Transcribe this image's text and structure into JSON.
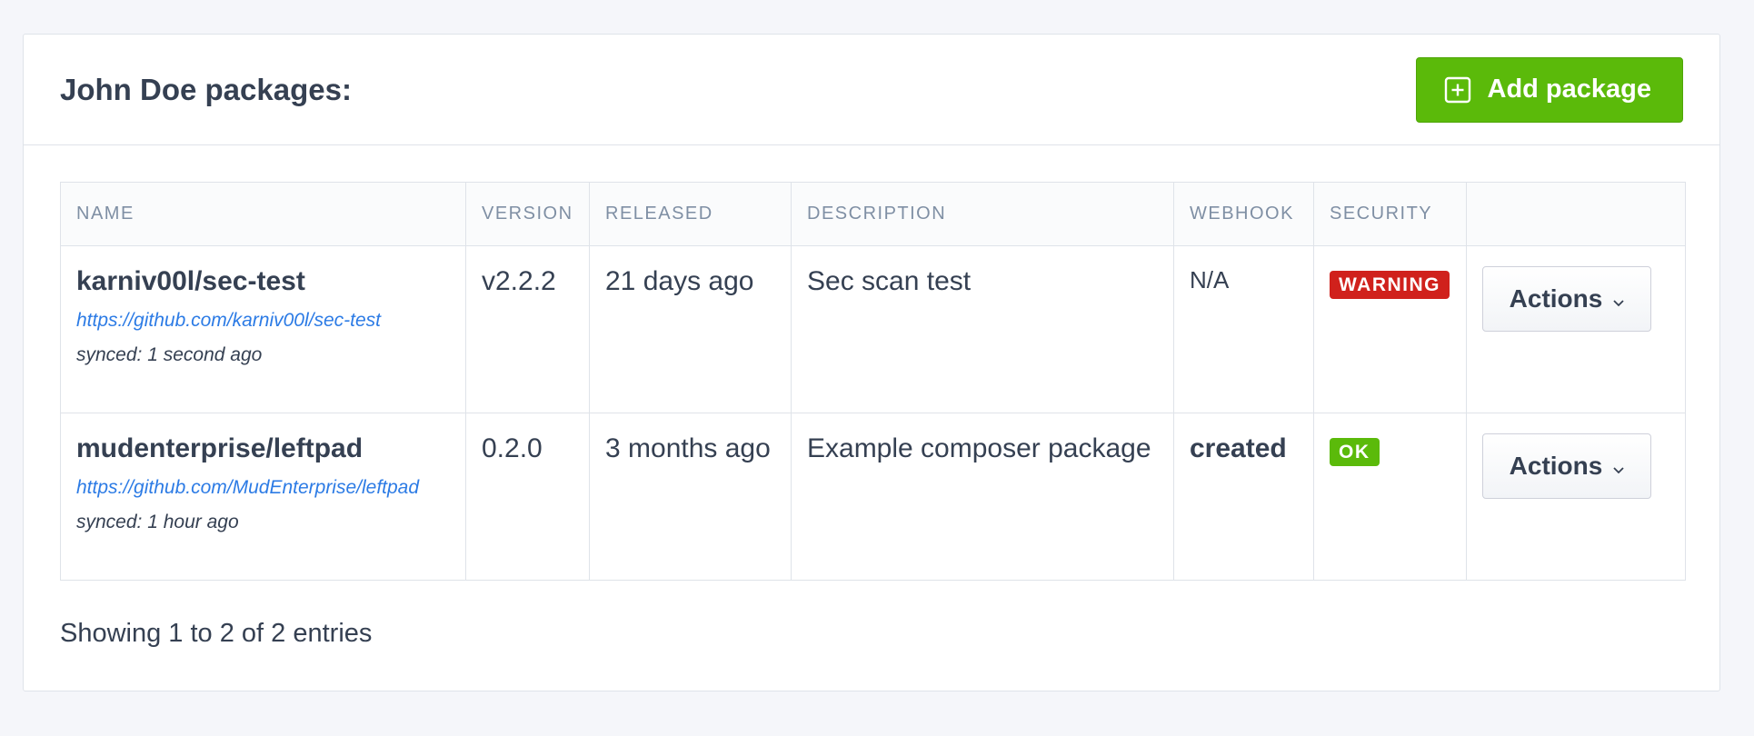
{
  "header": {
    "title": "John Doe packages:",
    "add_button_label": "Add package",
    "add_button_icon": "plus-square-icon"
  },
  "table": {
    "columns": [
      "NAME",
      "VERSION",
      "RELEASED",
      "DESCRIPTION",
      "WEBHOOK",
      "SECURITY",
      ""
    ],
    "rows": [
      {
        "name": "karniv00l/sec-test",
        "url": "https://github.com/karniv00l/sec-test",
        "synced": "synced: 1 second ago",
        "version": "v2.2.2",
        "released": "21 days ago",
        "description": "Sec scan test",
        "webhook": "N/A",
        "security": "WARNING",
        "security_status": "warning",
        "actions_label": "Actions"
      },
      {
        "name": "mudenterprise/leftpad",
        "url": "https://github.com/MudEnterprise/leftpad",
        "synced": "synced: 1 hour ago",
        "version": "0.2.0",
        "released": "3 months ago",
        "description": "Example composer package",
        "webhook": "created",
        "security": "OK",
        "security_status": "ok",
        "actions_label": "Actions"
      }
    ]
  },
  "footer": {
    "info": "Showing 1 to 2 of 2 entries"
  },
  "colors": {
    "primary_green": "#5bba0a",
    "warning_red": "#d0211c",
    "link_blue": "#2c7be5",
    "text": "#354052",
    "header_text": "#7f8fa4"
  }
}
